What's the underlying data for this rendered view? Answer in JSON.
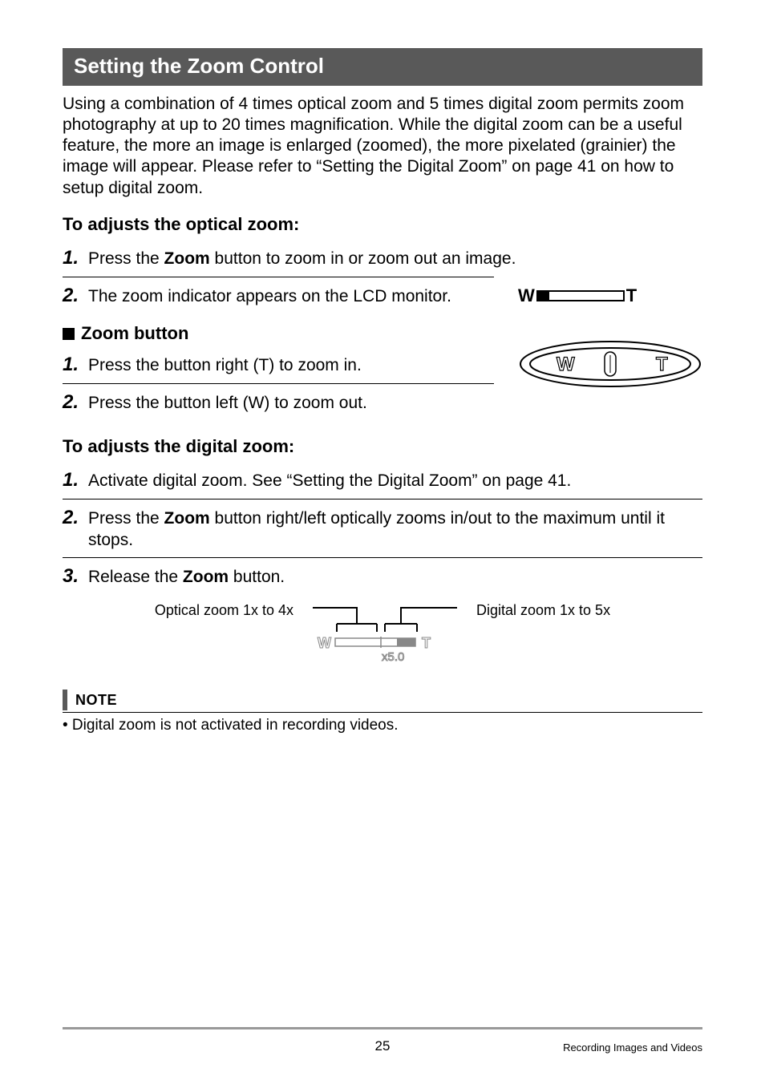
{
  "section_title": "Setting the Zoom Control",
  "intro": "Using a combination of 4 times optical zoom and 5 times digital zoom permits zoom photography at up to 20 times magnification. While the digital zoom can be a useful feature, the more an image is enlarged (zoomed), the more pixelated (grainier) the image will appear. Please refer to “Setting the Digital Zoom” on page 41 on how to setup digital zoom.",
  "optical": {
    "heading": "To adjusts the optical zoom:",
    "steps": {
      "s1_pre": "Press the ",
      "s1_b": "Zoom",
      "s1_post": " button to zoom in or zoom out an image.",
      "s2": "The zoom indicator appears on the LCD monitor."
    }
  },
  "zoom_button": {
    "heading": "Zoom button",
    "steps": {
      "s1": "Press the button right (T) to zoom in.",
      "s2": "Press the button left (W) to zoom out."
    }
  },
  "digital": {
    "heading": "To adjusts the digital zoom:",
    "steps": {
      "s1": "Activate digital zoom. See “Setting the Digital Zoom” on page 41.",
      "s2_pre": "Press the ",
      "s2_b": "Zoom",
      "s2_post": " button right/left optically zooms in/out to the maximum until it stops.",
      "s3_pre": "Release the ",
      "s3_b": "Zoom",
      "s3_post": " button."
    }
  },
  "diagram": {
    "left_label": "Optical zoom 1x to 4x",
    "right_label": "Digital zoom 1x to 5x",
    "scale_text": "x5.0"
  },
  "zoom_indicator": {
    "left": "W",
    "right": "T"
  },
  "zoom_physical": {
    "left": "W",
    "right": "T"
  },
  "note": {
    "label": "NOTE",
    "body": "• Digital zoom is not activated in recording videos."
  },
  "footer": {
    "page": "25",
    "right": "Recording Images and Videos"
  }
}
